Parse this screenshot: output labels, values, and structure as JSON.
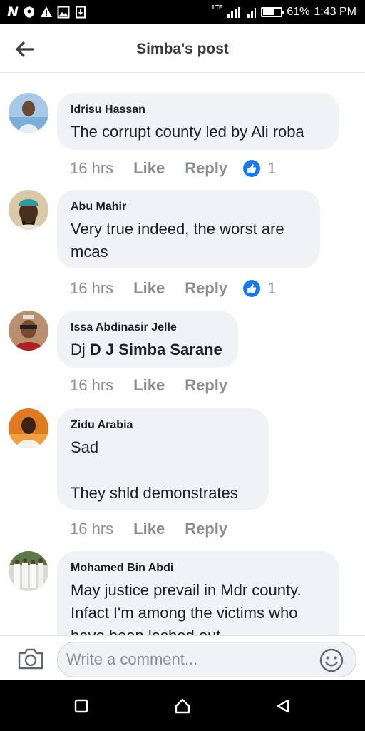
{
  "status_bar": {
    "left_glyph": "N",
    "left_icons": [
      "vpn-shield-icon",
      "warning-icon",
      "image-icon",
      "download-icon"
    ],
    "network": "LTE",
    "battery": "61%",
    "battery_level": 0.61,
    "time": "1:43 PM"
  },
  "header": {
    "back_icon": "arrow-left-icon",
    "title": "Simba's post"
  },
  "comments": [
    {
      "author": "Idrisu Hassan",
      "text": "The corrupt county led by Ali roba",
      "time": "16 hrs",
      "like_label": "Like",
      "reply_label": "Reply",
      "reactions": "1"
    },
    {
      "author": "Abu Mahir",
      "text": "Very true indeed, the worst  are\nmcas",
      "time": "16 hrs",
      "like_label": "Like",
      "reply_label": "Reply",
      "reactions": "1"
    },
    {
      "author": "Issa Abdinasir Jelle",
      "text_prefix": "Dj ",
      "mention": "D J Simba Sarane",
      "time": "16 hrs",
      "like_label": "Like",
      "reply_label": "Reply"
    },
    {
      "author": "Zidu Arabia",
      "text": "Sad\n\nThey shld demonstrates",
      "time": "16 hrs",
      "like_label": "Like",
      "reply_label": "Reply"
    },
    {
      "author": "Mohamed Bin Abdi",
      "text": "May justice prevail in Mdr county.\nInfact I'm among the victims who\nhave been lashed out"
    }
  ],
  "composer": {
    "placeholder": "Write a comment...",
    "camera_icon": "camera-icon",
    "emoji_icon": "emoji-icon"
  },
  "nav": {
    "icons": [
      "recent-apps-icon",
      "home-icon",
      "back-icon"
    ]
  },
  "colors": {
    "accent": "#1877f2",
    "bubble": "#f0f2f5",
    "secondary_text": "#8a8d91"
  }
}
